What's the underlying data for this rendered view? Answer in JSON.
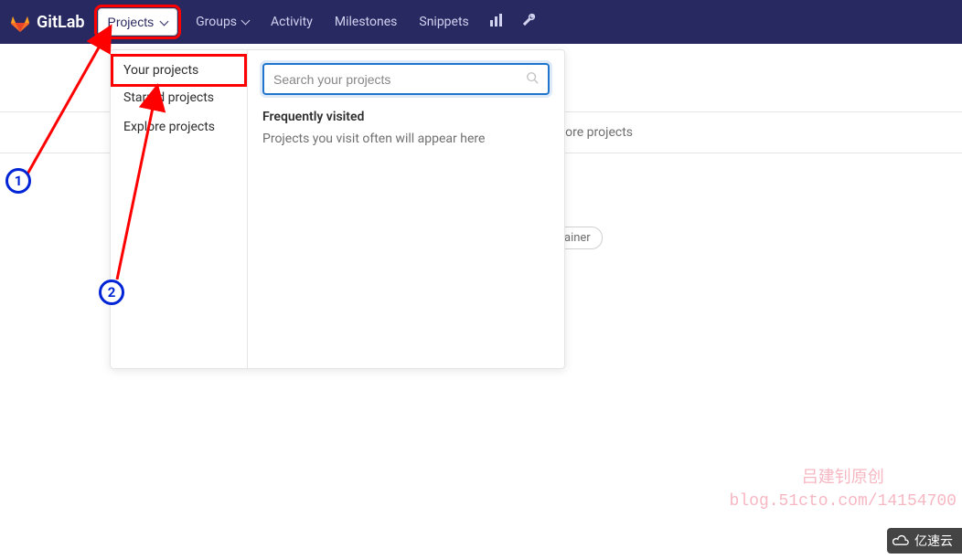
{
  "navbar": {
    "brand": "GitLab",
    "projects_btn": "Projects",
    "groups_link": "Groups",
    "activity_link": "Activity",
    "milestones_link": "Milestones",
    "snippets_link": "Snippets"
  },
  "dropdown": {
    "items": [
      "Your projects",
      "Starred projects",
      "Explore projects"
    ],
    "search_placeholder": "Search your projects",
    "freq_title": "Frequently visited",
    "freq_desc": "Projects you visit often will appear here"
  },
  "background": {
    "explore_fragment": "ore projects",
    "tag_fragment": "ainer"
  },
  "annotations": {
    "callout1": "1",
    "callout2": "2"
  },
  "attribution": {
    "line1": "吕建钊原创",
    "line2": "blog.51cto.com/14154700"
  },
  "brand_badge": "亿速云"
}
